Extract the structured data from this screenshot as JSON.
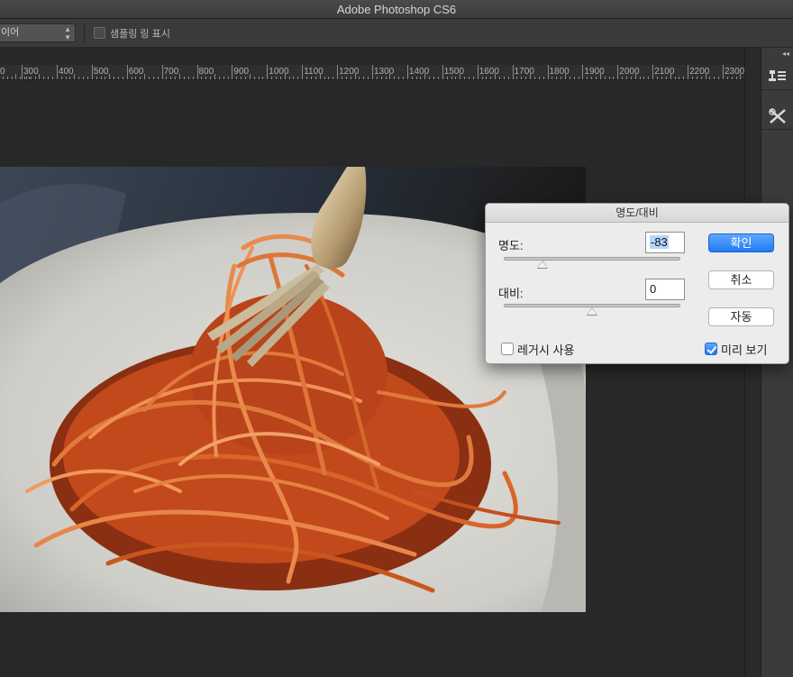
{
  "app": {
    "title": "Adobe Photoshop CS6"
  },
  "options_bar": {
    "layer_select_value": "이어",
    "sample_ring_label": "샘플링 링 표시",
    "sample_ring_checked": false
  },
  "ruler": {
    "labels": [
      "0",
      "300",
      "400",
      "500",
      "600",
      "700",
      "800",
      "900",
      "1000",
      "1100",
      "1200",
      "1300",
      "1400",
      "1500",
      "1600",
      "1700",
      "1800",
      "1900",
      "2000",
      "2100",
      "2200",
      "2300"
    ]
  },
  "dock": {
    "collapse_glyph": "◂◂",
    "tools": [
      {
        "name": "clone-source-icon"
      },
      {
        "name": "tool-presets-icon"
      }
    ]
  },
  "dialog": {
    "title": "명도/대비",
    "brightness": {
      "label": "명도:",
      "value": "-83",
      "slider_fraction": 0.22
    },
    "contrast": {
      "label": "대비:",
      "value": "0",
      "slider_fraction": 0.5
    },
    "legacy": {
      "label": "레거시 사용",
      "checked": false
    },
    "preview": {
      "label": "미리 보기",
      "checked": true
    },
    "buttons": {
      "ok": "확인",
      "cancel": "취소",
      "auto": "자동"
    }
  },
  "colors": {
    "accent": "#1f7bf1",
    "workspace": "#282828",
    "dialog_bg": "#ececec"
  }
}
